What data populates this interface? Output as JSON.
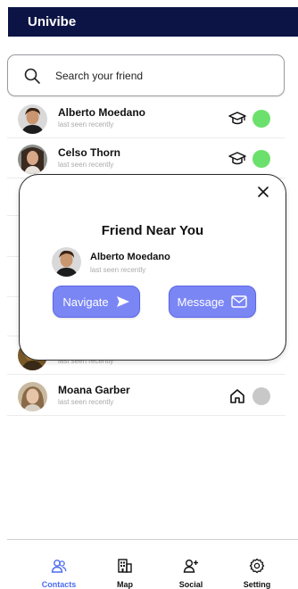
{
  "app": {
    "title": "Univibe"
  },
  "search": {
    "placeholder": "Search your friend"
  },
  "contacts": [
    {
      "name": "Alberto Moedano",
      "seen": "last seen recently",
      "place_icon": "graduation-cap-icon",
      "status_color": "#6ce06c"
    },
    {
      "name": "Celso Thorn",
      "seen": "last seen recently",
      "place_icon": "graduation-cap-icon",
      "status_color": "#6ce06c"
    },
    {
      "name": "",
      "seen": "last seen recently",
      "place_icon": "",
      "status_color": ""
    },
    {
      "name": "Moana Garber",
      "seen": "last seen recently",
      "place_icon": "home-icon",
      "status_color": "#c8c8c8"
    }
  ],
  "modal": {
    "title": "Friend Near You",
    "friend_name": "Alberto Moedano",
    "friend_seen": "last seen recently",
    "navigate_label": "Navigate",
    "message_label": "Message"
  },
  "bottom_nav": [
    {
      "label": "Contacts",
      "icon": "contacts-icon",
      "active": true
    },
    {
      "label": "Map",
      "icon": "building-icon",
      "active": false
    },
    {
      "label": "Social",
      "icon": "add-user-icon",
      "active": false
    },
    {
      "label": "Setting",
      "icon": "gear-icon",
      "active": false
    }
  ],
  "colors": {
    "header_bg": "#0c1445",
    "accent": "#7b86f5",
    "online": "#6ce06c",
    "offline": "#c8c8c8",
    "active_nav": "#4a6cf0"
  }
}
